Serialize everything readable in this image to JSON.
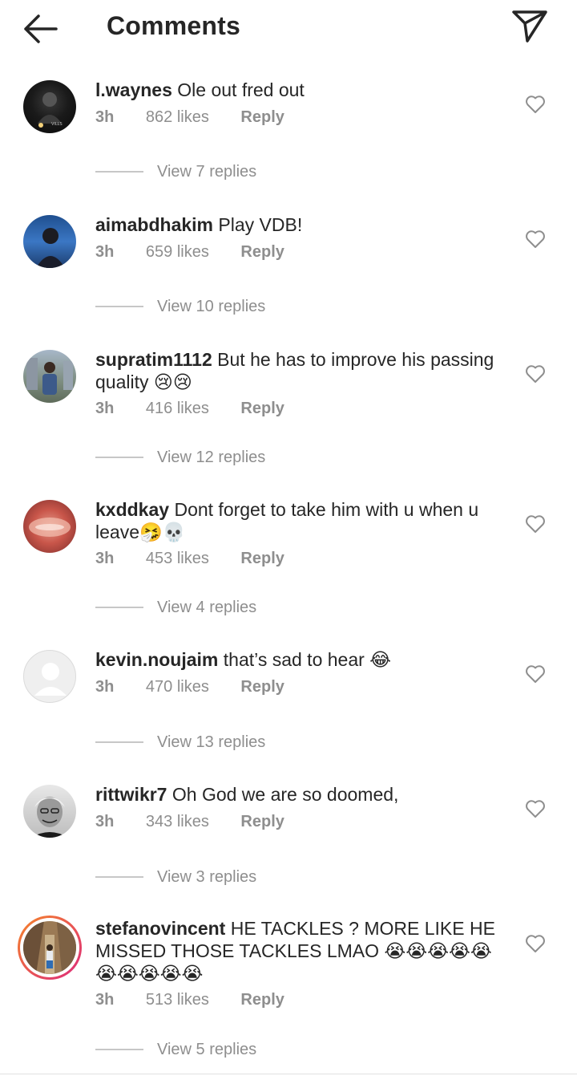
{
  "header": {
    "title": "Comments"
  },
  "comments": [
    {
      "username": "l.waynes",
      "text": "Ole out fred out",
      "time": "3h",
      "likes": "862 likes",
      "reply": "Reply",
      "replies": "View 7 replies"
    },
    {
      "username": "aimabdhakim",
      "text": "Play VDB!",
      "time": "3h",
      "likes": "659 likes",
      "reply": "Reply",
      "replies": "View 10 replies"
    },
    {
      "username": "supratim1112",
      "text": "But he has to improve his passing",
      "text2": "quality 😢😢",
      "time": "3h",
      "likes": "416 likes",
      "reply": "Reply",
      "replies": "View 12 replies"
    },
    {
      "username": "kxddkay",
      "text": "Dont forget to take him with u when u",
      "text2": "leave🤧💀",
      "time": "3h",
      "likes": "453 likes",
      "reply": "Reply",
      "replies": "View 4 replies"
    },
    {
      "username": "kevin.noujaim",
      "text": "that’s sad to hear 😂",
      "time": "3h",
      "likes": "470 likes",
      "reply": "Reply",
      "replies": "View 13 replies"
    },
    {
      "username": "rittwikr7",
      "text": "Oh God we are so doomed,",
      "time": "3h",
      "likes": "343 likes",
      "reply": "Reply",
      "replies": "View 3 replies"
    },
    {
      "username": "stefanovincent",
      "text": "HE TACKLES ? MORE LIKE HE",
      "text2": "MISSED THOSE TACKLES LMAO 😭😭😭😭😭",
      "text3": "😭😭😭😭😭",
      "time": "3h",
      "likes": "513 likes",
      "reply": "Reply",
      "replies": "View 5 replies"
    }
  ],
  "colors": {
    "text": "#262626",
    "secondary": "#8e8e8e",
    "story_ring_start": "#f58529",
    "story_ring_end": "#dd2a7b"
  },
  "icons": {
    "back": "arrow-left-icon",
    "send": "paper-plane-icon",
    "like": "heart-outline-icon"
  }
}
